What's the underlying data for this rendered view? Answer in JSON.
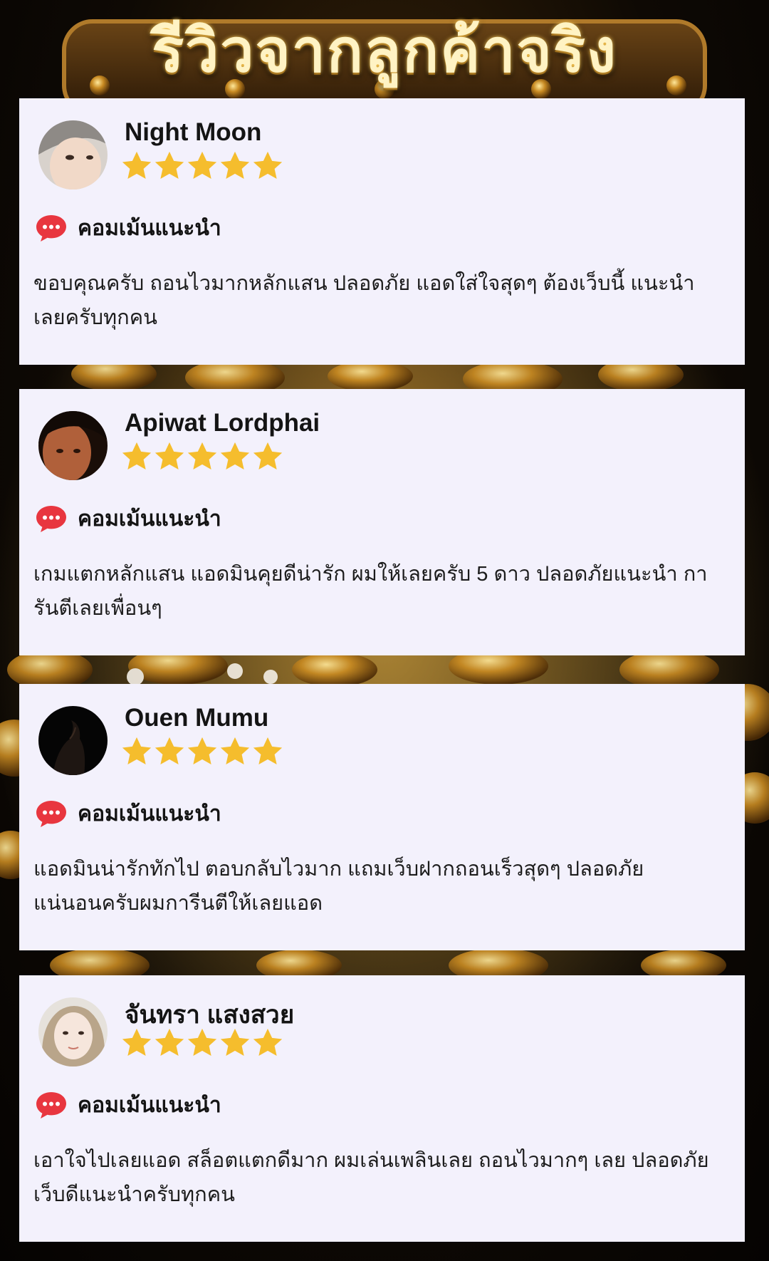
{
  "headline": "รีวิวจากลูกค้าจริง",
  "colors": {
    "star": "#f5bd2d",
    "chat_bubble": "#e8363f",
    "card_bg": "#f3f1fc"
  },
  "reviews": [
    {
      "name": "Night Moon",
      "rating": 5,
      "comment_label": "คอมเม้นแนะนำ",
      "text": "ขอบคุณครับ ถอนไวมากหลักแสน ปลอดภัย แอดใส่ใจสุดๆ ต้องเว็บนี้ แนะนำเลยครับทุกคน"
    },
    {
      "name": "Apiwat Lordphai",
      "rating": 5,
      "comment_label": "คอมเม้นแนะนำ",
      "text": "เกมแตกหลักแสน แอดมินคุยดีน่ารัก ผมให้เลยครับ 5 ดาว ปลอดภัยแนะนำ การันตีเลยเพื่อนๆ"
    },
    {
      "name": "Ouen Mumu",
      "rating": 5,
      "comment_label": "คอมเม้นแนะนำ",
      "text": "แอดมินน่ารักทักไป ตอบกลับไวมาก แถมเว็บฝากถอนเร็วสุดๆ ปลอดภัย แน่นอนครับผมการีนตีให้เลยแอด"
    },
    {
      "name": "จันทรา แสงสวย",
      "rating": 5,
      "comment_label": "คอมเม้นแนะนำ",
      "text": "เอาใจไปเลยแอด สล็อตแตกดีมาก ผมเล่นเพลินเลย ถอนไวมากๆ เลย ปลอดภัย เว็บดีแนะนำครับทุกคน"
    }
  ]
}
